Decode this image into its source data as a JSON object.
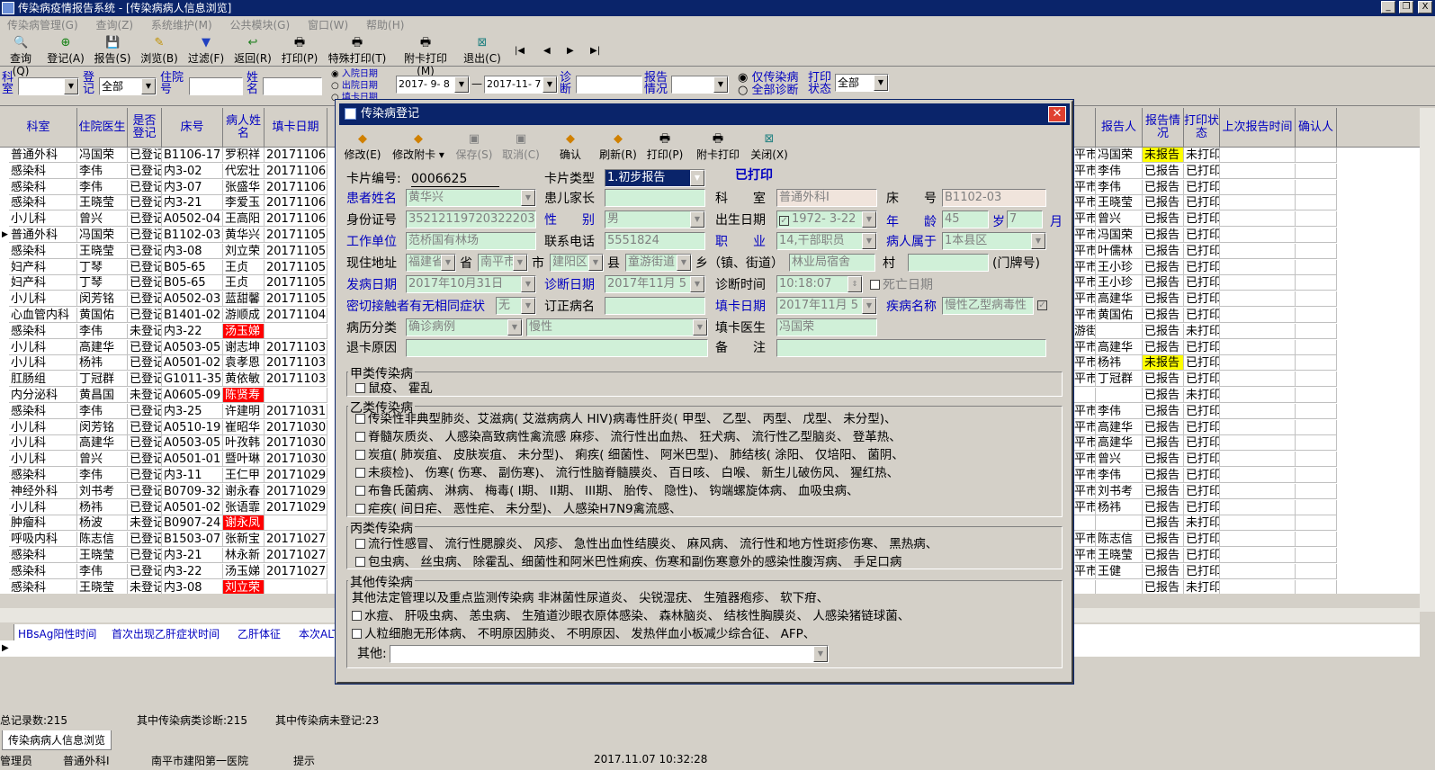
{
  "window": {
    "title": "传染病疫情报告系统 - [传染病病人信息浏览]",
    "btn_min": "_",
    "btn_max": "❐",
    "btn_close": "X"
  },
  "menu": [
    "传染病管理(G)",
    "查询(Z)",
    "系统维护(M)",
    "公共模块(G)",
    "窗口(W)",
    "帮助(H)"
  ],
  "toolbar": [
    {
      "label": "查询(Q)",
      "icon": "🔍"
    },
    {
      "label": "登记(A)",
      "icon": "⊕"
    },
    {
      "label": "报告(S)",
      "icon": "💾"
    },
    {
      "label": "浏览(B)",
      "icon": "✎"
    },
    {
      "label": "过滤(F)",
      "icon": "▼"
    },
    {
      "label": "返回(R)",
      "icon": "↩"
    },
    {
      "label": "打印(P)",
      "icon": "🖶"
    },
    {
      "label": "特殊打印(T)",
      "icon": "🖶"
    },
    {
      "label": "附卡打印(M)",
      "icon": "🖶"
    },
    {
      "label": "退出(C)",
      "icon": "⊠"
    }
  ],
  "nav": [
    "|◀",
    "◀",
    "▶",
    "▶|"
  ],
  "filter": {
    "dept_label": "科室",
    "reg_label": "登记",
    "reg_value": "全部",
    "ward_label": "住院号",
    "name_label": "姓名",
    "date_options": [
      "入院日期",
      "出院日期",
      "填卡日期"
    ],
    "date_from": "2017- 9- 8",
    "date_sep": "—",
    "date_to": "2017-11- 7",
    "diag_label": "诊断",
    "report_label": "报告情况",
    "only_label": "仅传染病",
    "all_label": "全部诊断",
    "print_label": "打印状态",
    "print_value": "全部"
  },
  "grid": {
    "left_headers": [
      "科室",
      "住院医生",
      "是否登记",
      "床号",
      "病人姓名",
      "填卡日期"
    ],
    "right_headers": [
      "报告人",
      "报告情况",
      "打印状态",
      "上次报告时间",
      "确认人"
    ],
    "rows": [
      [
        "普通外科",
        "冯国荣",
        "已登记",
        "B1106-17",
        "罗积祥",
        "20171106",
        "平市",
        "冯国荣",
        "未报告",
        "未打印",
        "y",
        "n"
      ],
      [
        "感染科",
        "李伟",
        "已登记",
        "内3-02",
        "代宏壮",
        "20171106",
        "平市",
        "李伟",
        "已报告",
        "已打印",
        "n",
        "n"
      ],
      [
        "感染科",
        "李伟",
        "已登记",
        "内3-07",
        "张盛华",
        "20171106",
        "平市",
        "李伟",
        "已报告",
        "已打印",
        "n",
        "n"
      ],
      [
        "感染科",
        "王晓莹",
        "已登记",
        "内3-21",
        "李爱玉",
        "20171106",
        "平市",
        "王晓莹",
        "已报告",
        "已打印",
        "n",
        "n"
      ],
      [
        "小儿科",
        "曾兴",
        "已登记",
        "A0502-04",
        "王高阳",
        "20171106",
        "平市",
        "曾兴",
        "已报告",
        "已打印",
        "n",
        "n"
      ],
      [
        "普通外科",
        "冯国荣",
        "已登记",
        "B1102-03",
        "黄华兴",
        "20171105",
        "平市",
        "冯国荣",
        "已报告",
        "已打印",
        "n",
        "n"
      ],
      [
        "感染科",
        "王晓莹",
        "已登记",
        "内3-08",
        "刘立荣",
        "20171105",
        "平市",
        "叶儒林",
        "已报告",
        "已打印",
        "n",
        "n"
      ],
      [
        "妇产科",
        "丁琴",
        "已登记",
        "B05-65",
        "王贞",
        "20171105",
        "平市",
        "王小珍",
        "已报告",
        "已打印",
        "n",
        "n"
      ],
      [
        "妇产科",
        "丁琴",
        "已登记",
        "B05-65",
        "王贞",
        "20171105",
        "平市",
        "王小珍",
        "已报告",
        "已打印",
        "n",
        "n"
      ],
      [
        "小儿科",
        "闵芳铭",
        "已登记",
        "A0502-03",
        "蓝甜馨",
        "20171105",
        "平市",
        "高建华",
        "已报告",
        "已打印",
        "n",
        "n"
      ],
      [
        "心血管内科",
        "黄国佑",
        "已登记",
        "B1401-02",
        "游顺成",
        "20171104",
        "平市",
        "黄国佑",
        "已报告",
        "已打印",
        "n",
        "n"
      ],
      [
        "感染科",
        "李伟",
        "未登记",
        "内3-22",
        "汤玉娣",
        "",
        "游街",
        "",
        "已报告",
        "未打印",
        "n",
        "y"
      ],
      [
        "小儿科",
        "高建华",
        "已登记",
        "A0503-05",
        "谢志坤",
        "20171103",
        "平市",
        "高建华",
        "已报告",
        "已打印",
        "n",
        "n"
      ],
      [
        "小儿科",
        "杨祎",
        "已登记",
        "A0501-02",
        "袁孝恩",
        "20171103",
        "平市",
        "杨祎",
        "未报告",
        "已打印",
        "y",
        "n"
      ],
      [
        "肛肠组",
        "丁冠群",
        "已登记",
        "G1011-35",
        "黄依敏",
        "20171103",
        "平市",
        "丁冠群",
        "已报告",
        "已打印",
        "n",
        "n"
      ],
      [
        "内分泌科",
        "黄昌国",
        "未登记",
        "A0605-09",
        "陈贤寿",
        "",
        "",
        "",
        "已报告",
        "未打印",
        "n",
        "y"
      ],
      [
        "感染科",
        "李伟",
        "已登记",
        "内3-25",
        "许建明",
        "20171031",
        "平市",
        "李伟",
        "已报告",
        "已打印",
        "n",
        "n"
      ],
      [
        "小儿科",
        "闵芳铭",
        "已登记",
        "A0510-19",
        "崔昭华",
        "20171030",
        "平市",
        "高建华",
        "已报告",
        "已打印",
        "n",
        "n"
      ],
      [
        "小儿科",
        "高建华",
        "已登记",
        "A0503-05",
        "叶孜韩",
        "20171030",
        "平市",
        "高建华",
        "已报告",
        "已打印",
        "n",
        "n"
      ],
      [
        "小儿科",
        "曾兴",
        "已登记",
        "A0501-01",
        "暨叶琳",
        "20171030",
        "平市",
        "曾兴",
        "已报告",
        "已打印",
        "n",
        "n"
      ],
      [
        "感染科",
        "李伟",
        "已登记",
        "内3-11",
        "王仁甲",
        "20171029",
        "平市",
        "李伟",
        "已报告",
        "已打印",
        "n",
        "n"
      ],
      [
        "神经外科",
        "刘书考",
        "已登记",
        "B0709-32",
        "谢永春",
        "20171029",
        "平市",
        "刘书考",
        "已报告",
        "已打印",
        "n",
        "n"
      ],
      [
        "小儿科",
        "杨祎",
        "已登记",
        "A0501-02",
        "张语霏",
        "20171029",
        "平市",
        "杨祎",
        "已报告",
        "已打印",
        "n",
        "n"
      ],
      [
        "肿瘤科",
        "杨波",
        "未登记",
        "B0907-24",
        "谢永凤",
        "",
        "",
        "",
        "已报告",
        "未打印",
        "n",
        "y"
      ],
      [
        "呼吸内科",
        "陈志信",
        "已登记",
        "B1503-07",
        "张新宝",
        "20171027",
        "平市",
        "陈志信",
        "已报告",
        "已打印",
        "n",
        "n"
      ],
      [
        "感染科",
        "王晓莹",
        "已登记",
        "内3-21",
        "林永新",
        "20171027",
        "平市",
        "王晓莹",
        "已报告",
        "已打印",
        "n",
        "n"
      ],
      [
        "感染科",
        "李伟",
        "已登记",
        "内3-22",
        "汤玉娣",
        "20171027",
        "平市",
        "王健",
        "已报告",
        "已打印",
        "n",
        "n"
      ],
      [
        "感染科",
        "王晓莹",
        "未登记",
        "内3-08",
        "刘立荣",
        "",
        "",
        "",
        "已报告",
        "未打印",
        "n",
        "y"
      ]
    ]
  },
  "subgrid": {
    "headers": [
      "HBsAg阳性时间",
      "首次出现乙肝症状时间",
      "乙肝体征",
      "本次ALT"
    ]
  },
  "status": {
    "total": "总记录数:215",
    "diag": "其中传染病类诊断:215",
    "unreg": "其中传染病未登记:23"
  },
  "tab": "传染病病人信息浏览",
  "statusbar": [
    "管理员",
    "普通外科Ⅰ",
    "南平市建阳第一医院",
    "提示",
    "2017.11.07 10:32:28"
  ],
  "dialog": {
    "title": "传染病登记",
    "toolbar": [
      "修改(E)",
      "修改附卡",
      "保存(S)",
      "取消(C)",
      "确认",
      "刷新(R)",
      "打印(P)",
      "附卡打印",
      "关闭(X)"
    ],
    "card_no_label": "卡片编号:",
    "card_no": "0006625",
    "card_type_label": "卡片类型",
    "card_type": "1.初步报告",
    "printed": "已打印",
    "patient_label": "患者姓名",
    "patient": "黄华兴",
    "guardian_label": "患儿家长",
    "dept_label": "科　　室",
    "dept": "普通外科Ⅰ",
    "bed_label": "床　　号",
    "bed": "B1102-03",
    "id_label": "身份证号",
    "id": "352121197203222031",
    "sex_label": "性　　别",
    "sex": "男",
    "birth_label": "出生日期",
    "birth": "1972- 3-22",
    "age_label": "年　　龄",
    "age": "45",
    "age_unit": "岁",
    "month": "7",
    "month_unit": "月",
    "work_label": "工作单位",
    "work": "范桥国有林场",
    "phone_label": "联系电话",
    "phone": "5551824",
    "job_label": "职　　业",
    "job": "14,干部职员",
    "belong_label": "病人属于",
    "belong": "1本县区",
    "addr_label": "现住地址",
    "prov": "福建省",
    "prov_unit": "省",
    "city": "南平市",
    "city_unit": "市",
    "county": "建阳区",
    "county_unit": "县",
    "town": "童游街道",
    "town_unit": "乡（镇、街道）",
    "village": "林业局宿舍",
    "village_unit": "村",
    "door_unit": "(门牌号)",
    "onset_label": "发病日期",
    "onset": "2017年10月31日",
    "diag_label": "诊断日期",
    "diag": "2017年11月 5",
    "diag_time_label": "诊断时间",
    "diag_time": "10:18:07",
    "death_label": "死亡日期",
    "contact_label": "密切接触者有无相同症状",
    "contact": "无",
    "revise_label": "订正病名",
    "fill_label": "填卡日期",
    "fill": "2017年11月 5",
    "disease_label": "疾病名称",
    "disease": "慢性乙型病毒性",
    "class_label": "病历分类",
    "class1": "确诊病例",
    "class2": "慢性",
    "doctor_label": "填卡医生",
    "doctor": "冯国荣",
    "withdraw_label": "退卡原因",
    "note_label": "备　　注",
    "groupA": "甲类传染病",
    "groupA_items": "鼠疫、 霍乱",
    "groupB": "乙类传染病",
    "groupB_lines": [
      "传染性非典型肺炎、艾滋病(  艾滋病病人   HIV)病毒性肝炎(  甲型、  乙型、  丙型、  戊型、  未分型)、",
      "脊髓灰质炎、  人感染高致病性禽流感   麻疹、  流行性出血热、  狂犬病、  流行性乙型脑炎、  登革热、",
      "炭疽(  肺炭疽、  皮肤炭疽、  未分型)、  痢疾(  细菌性、  阿米巴型)、  肺结核(  涂阳、  仅培阳、  菌阴、",
      "未痰检)、  伤寒(  伤寒、  副伤寒)、  流行性脑脊髓膜炎、  百日咳、  白喉、  新生儿破伤风、  猩红热、",
      "布鲁氏菌病、  淋病、  梅毒(  I期、  II期、  III期、  胎传、  隐性)、  钩端螺旋体病、  血吸虫病、",
      "疟疾(  间日疟、  恶性疟、  未分型)、  人感染H7N9禽流感、"
    ],
    "groupC": "丙类传染病",
    "groupC_lines": [
      "流行性感冒、  流行性腮腺炎、  风疹、  急性出血性结膜炎、  麻风病、  流行性和地方性斑疹伤寒、  黑热病、",
      "包虫病、  丝虫病、  除霍乱、细菌性和阿米巴性痢疾、伤寒和副伤寒意外的感染性腹泻病、  手足口病"
    ],
    "groupD": "其他传染病",
    "groupD_lines": [
      "其他法定管理以及重点监测传染病   非淋菌性尿道炎、  尖锐湿疣、  生殖器疱疹、                  软下疳、",
      "水痘、  肝吸虫病、  恙虫病、  生殖道沙眼衣原体感染、  森林脑炎、  结核性胸膜炎、  人感染猪链球菌、",
      "人粒细胞无形体病、  不明原因肺炎、  不明原因、  发热伴血小板减少综合征、  AFP、"
    ],
    "other_label": "其他:"
  }
}
